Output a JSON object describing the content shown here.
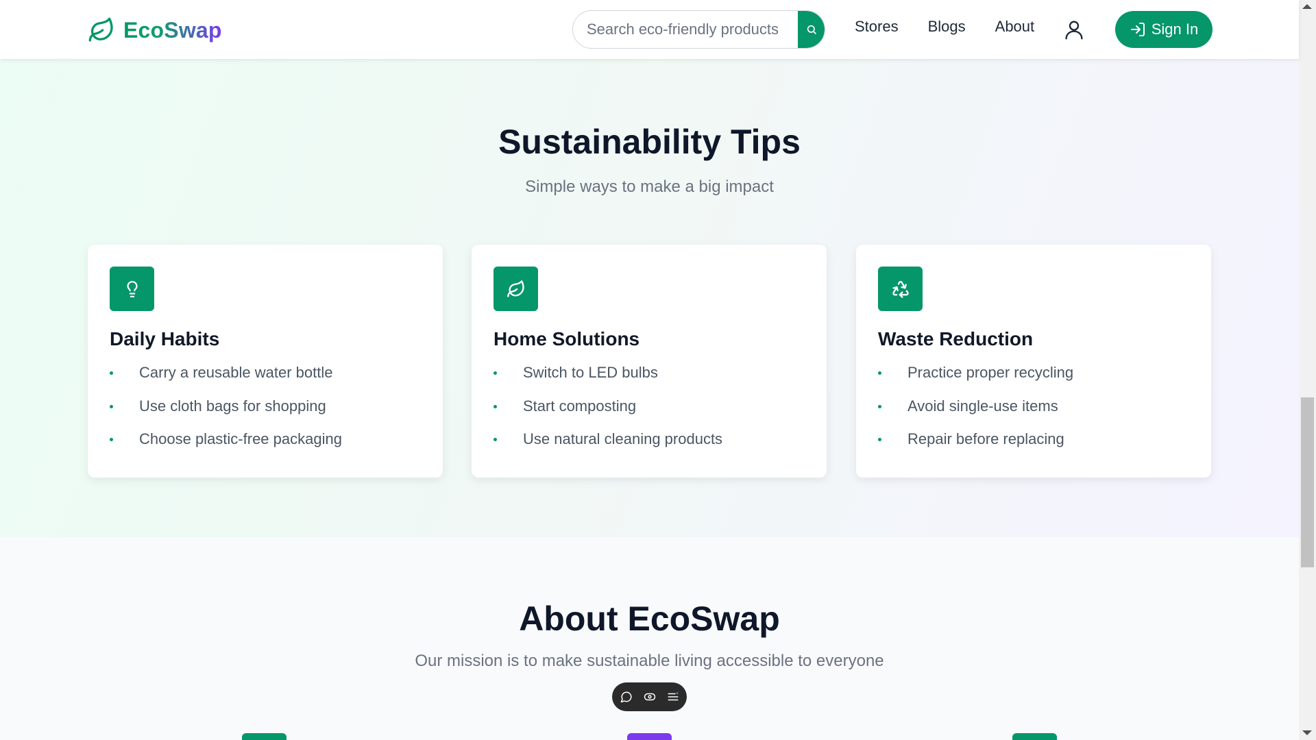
{
  "header": {
    "brand": "EcoSwap",
    "search_placeholder": "Search eco-friendly products",
    "nav": [
      "Stores",
      "Blogs",
      "About"
    ],
    "signin_label": "Sign In"
  },
  "tips": {
    "title": "Sustainability Tips",
    "subtitle": "Simple ways to make a big impact",
    "cards": [
      {
        "icon": "lightbulb-icon",
        "title": "Daily Habits",
        "items": [
          "Carry a reusable water bottle",
          "Use cloth bags for shopping",
          "Choose plastic-free packaging"
        ]
      },
      {
        "icon": "leaf-icon",
        "title": "Home Solutions",
        "items": [
          "Switch to LED bulbs",
          "Start composting",
          "Use natural cleaning products"
        ]
      },
      {
        "icon": "recycle-icon",
        "title": "Waste Reduction",
        "items": [
          "Practice proper recycling",
          "Avoid single-use items",
          "Repair before replacing"
        ]
      }
    ]
  },
  "about": {
    "title": "About EcoSwap",
    "subtitle": "Our mission is to make sustainable living accessible to everyone"
  },
  "colors": {
    "primary": "#059669",
    "accent_purple": "#7c3aed",
    "heading": "#0f172a",
    "body_text": "#4b5563"
  }
}
